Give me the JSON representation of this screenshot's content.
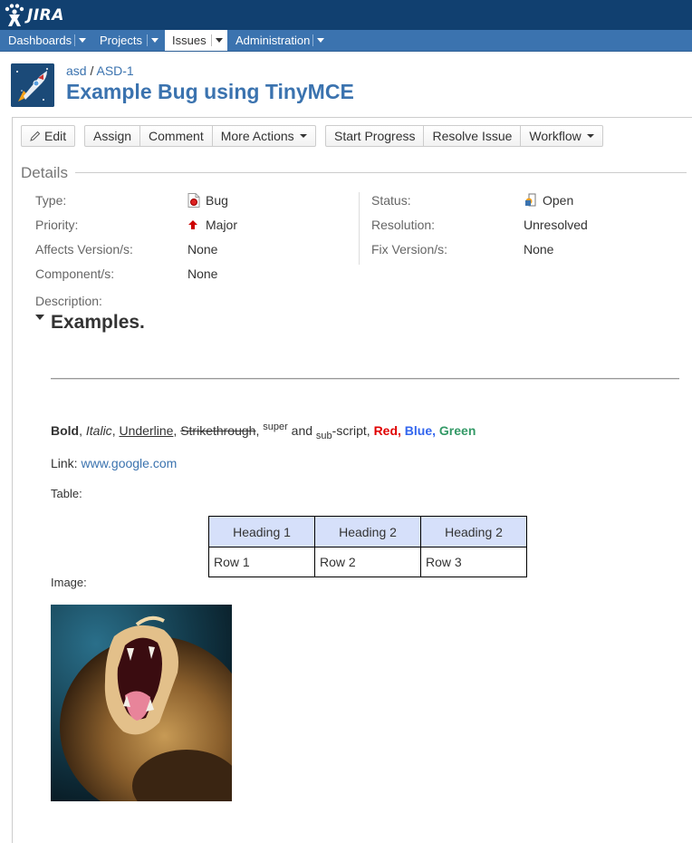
{
  "app": {
    "logo_text": "JIRA"
  },
  "nav": {
    "items": [
      {
        "label": "Dashboards"
      },
      {
        "label": "Projects"
      },
      {
        "label": "Issues"
      },
      {
        "label": "Administration"
      }
    ]
  },
  "issue": {
    "breadcrumb": {
      "project": "asd",
      "separator": "/",
      "key": "ASD-1"
    },
    "title": "Example Bug using TinyMCE"
  },
  "toolbar": {
    "edit": "Edit",
    "assign": "Assign",
    "comment": "Comment",
    "more_actions": "More Actions",
    "start_progress": "Start Progress",
    "resolve_issue": "Resolve Issue",
    "workflow": "Workflow"
  },
  "details": {
    "section_title": "Details",
    "type_label": "Type:",
    "type_value": "Bug",
    "priority_label": "Priority:",
    "priority_value": "Major",
    "affects_label": "Affects Version/s:",
    "affects_value": "None",
    "component_label": "Component/s:",
    "component_value": "None",
    "status_label": "Status:",
    "status_value": "Open",
    "resolution_label": "Resolution:",
    "resolution_value": "Unresolved",
    "fix_label": "Fix Version/s:",
    "fix_value": "None"
  },
  "description": {
    "label": "Description:",
    "heading": "Examples.",
    "formatting": {
      "bold": "Bold",
      "sep1": ", ",
      "italic": "Italic",
      "sep2": ", ",
      "underline": "Underline",
      "sep3": ", ",
      "strike": "Strikethrough",
      "sep4": ", ",
      "sup": "super",
      "and": " and ",
      "sub": "sub",
      "script": "-script, ",
      "red": "Red",
      "sep5": ", ",
      "blue": "Blue",
      "sep6": ", ",
      "green": "Green"
    },
    "link_label": "Link: ",
    "link_text": "www.google.com",
    "table_label": "Table:",
    "table": {
      "headers": [
        "Heading 1",
        "Heading 2",
        "Heading 2"
      ],
      "rows": [
        [
          "Row 1",
          "Row 2",
          "Row 3"
        ]
      ]
    },
    "image_label": "Image:"
  },
  "colors": {
    "header_bg": "#114070",
    "nav_bg": "#3b73af",
    "link": "#3b73af",
    "table_header_bg": "#d6e0fa",
    "red": "#e00000",
    "blue": "#3366ee",
    "green": "#339966"
  },
  "icons": {
    "logo": "jira-logo-icon",
    "edit": "pencil-icon",
    "type": "bug-icon",
    "priority": "major-priority-arrow-icon",
    "status": "open-status-icon",
    "avatar": "rocket-project-avatar-icon",
    "collapse": "collapse-triangle-icon"
  }
}
